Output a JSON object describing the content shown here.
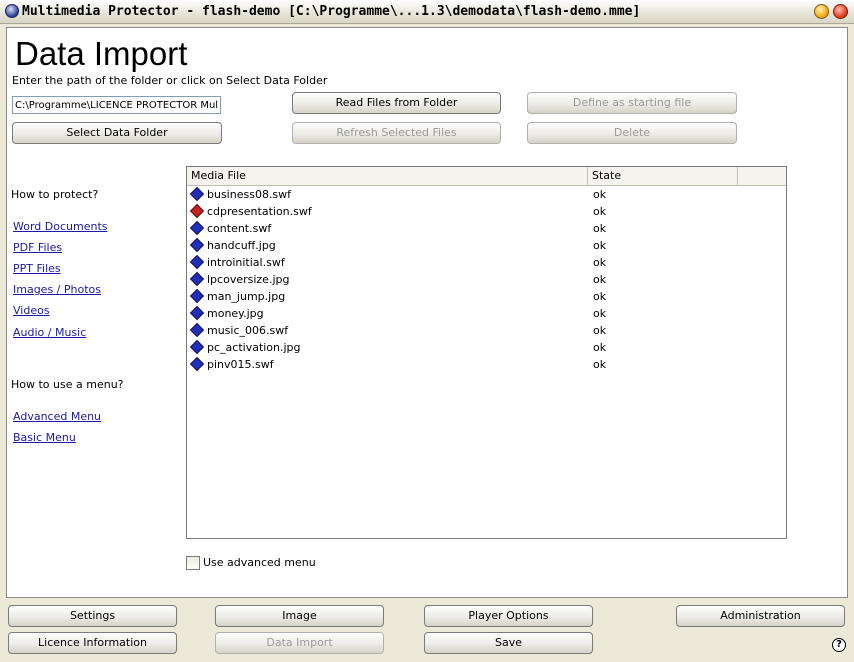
{
  "window": {
    "title": "Multimedia Protector - flash-demo [C:\\Programme\\...1.3\\demodata\\flash-demo.mme]"
  },
  "page": {
    "title": "Data Import",
    "instruction": "Enter the path of the folder or click on Select Data Folder",
    "path_value": "C:\\Programme\\LICENCE PROTECTOR Multi"
  },
  "buttons": {
    "read_files": "Read Files from Folder",
    "define_start": "Define as starting file",
    "select_folder": "Select Data Folder",
    "refresh_selected": "Refresh Selected Files",
    "delete": "Delete"
  },
  "sidebar": {
    "protect_heading": "How to protect?",
    "protect_links": [
      "Word Documents",
      "PDF Files",
      "PPT Files",
      "Images / Photos",
      "Videos",
      "Audio / Music"
    ],
    "menu_heading": "How to use a menu?",
    "menu_links": [
      "Advanced Menu",
      "Basic Menu"
    ]
  },
  "file_list": {
    "columns": [
      "Media File",
      "State"
    ],
    "rows": [
      {
        "name": "business08.swf",
        "state": "ok",
        "icon": "blue-file-icon"
      },
      {
        "name": "cdpresentation.swf",
        "state": "ok",
        "icon": "red-file-icon"
      },
      {
        "name": "content.swf",
        "state": "ok",
        "icon": "blue-file-icon"
      },
      {
        "name": "handcuff.jpg",
        "state": "ok",
        "icon": "blue-file-icon"
      },
      {
        "name": "introinitial.swf",
        "state": "ok",
        "icon": "blue-file-icon"
      },
      {
        "name": "lpcoversize.jpg",
        "state": "ok",
        "icon": "blue-file-icon"
      },
      {
        "name": "man_jump.jpg",
        "state": "ok",
        "icon": "blue-file-icon"
      },
      {
        "name": "money.jpg",
        "state": "ok",
        "icon": "blue-file-icon"
      },
      {
        "name": "music_006.swf",
        "state": "ok",
        "icon": "blue-file-icon"
      },
      {
        "name": "pc_activation.jpg",
        "state": "ok",
        "icon": "blue-file-icon"
      },
      {
        "name": "pinv015.swf",
        "state": "ok",
        "icon": "blue-file-icon"
      }
    ]
  },
  "options": {
    "advanced_menu_label": "Use advanced menu",
    "advanced_menu_checked": false
  },
  "bottom_nav": {
    "settings": "Settings",
    "image": "Image",
    "player_options": "Player Options",
    "administration": "Administration",
    "licence_info": "Licence Information",
    "data_import": "Data Import",
    "save": "Save"
  },
  "help_glyph": "?"
}
